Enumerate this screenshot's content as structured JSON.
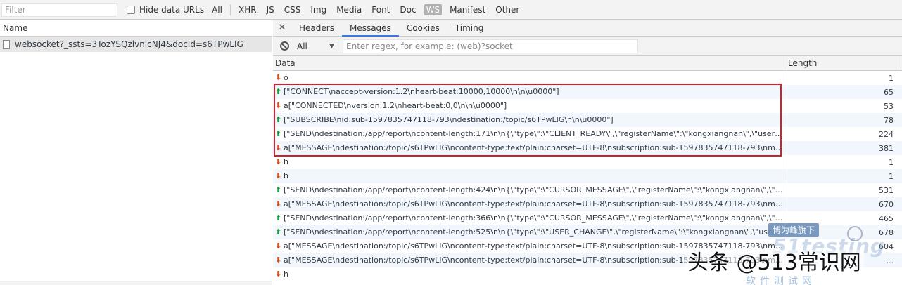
{
  "filterbar": {
    "filter_placeholder": "Filter",
    "hide_data_urls_label": "Hide data URLs",
    "types": [
      "All",
      "XHR",
      "JS",
      "CSS",
      "Img",
      "Media",
      "Font",
      "Doc",
      "WS",
      "Manifest",
      "Other"
    ],
    "active_type": "WS"
  },
  "left": {
    "column_header": "Name",
    "request_name": "websocket?_ssts=3TozYSQzlvnlcNJ4&docId=s6TPwLIG"
  },
  "right": {
    "tabs": [
      "Headers",
      "Messages",
      "Cookies",
      "Timing"
    ],
    "active_tab": "Messages",
    "filter_select": "All",
    "regex_placeholder": "Enter regex, for example: (web)?socket",
    "col_data": "Data",
    "col_length": "Length",
    "messages": [
      {
        "dir": "recv",
        "data": "o",
        "length": "1"
      },
      {
        "dir": "sent",
        "data": "[\"CONNECT\\naccept-version:1.2\\nheart-beat:10000,10000\\n\\n\\u0000\"]",
        "length": "65"
      },
      {
        "dir": "recv",
        "data": "a[\"CONNECTED\\nversion:1.2\\nheart-beat:0,0\\n\\n\\u0000\"]",
        "length": "53"
      },
      {
        "dir": "sent",
        "data": "[\"SUBSCRIBE\\nid:sub-1597835747118-793\\ndestination:/topic/s6TPwLIG\\n\\n\\u0000\"]",
        "length": "78"
      },
      {
        "dir": "sent",
        "data": "[\"SEND\\ndestination:/app/report\\ncontent-length:171\\n\\n{\\\"type\\\":\\\"CLIENT_READY\\\",\\\"registerName\\\":\\\"kongxiangnan\\\",\\\"userId\\\":...",
        "length": "224"
      },
      {
        "dir": "recv",
        "data": "a[\"MESSAGE\\ndestination:/topic/s6TPwLIG\\ncontent-type:text/plain;charset=UTF-8\\nsubscription:sub-1597835747118-793\\nmessa...",
        "length": "381"
      },
      {
        "dir": "recv",
        "data": "h",
        "length": "1"
      },
      {
        "dir": "recv",
        "data": "h",
        "length": "1"
      },
      {
        "dir": "sent",
        "data": "[\"SEND\\ndestination:/app/report\\ncontent-length:424\\n\\n{\\\"type\\\":\\\"CURSOR_MESSAGE\\\",\\\"registerName\\\":\\\"kongxiangnan\\\",\\\"user...",
        "length": "531"
      },
      {
        "dir": "recv",
        "data": "a[\"MESSAGE\\ndestination:/topic/s6TPwLIG\\ncontent-type:text/plain;charset=UTF-8\\nsubscription:sub-1597835747118-793\\nmessa...",
        "length": "670"
      },
      {
        "dir": "sent",
        "data": "[\"SEND\\ndestination:/app/report\\ncontent-length:366\\n\\n{\\\"type\\\":\\\"CURSOR_MESSAGE\\\",\\\"registerName\\\":\\\"kongxiangnan\\\",\\\"user...",
        "length": "465"
      },
      {
        "dir": "sent",
        "data": "[\"SEND\\ndestination:/app/report\\ncontent-length:525\\n\\n{\\\"type\\\":\\\"USER_CHANGE\\\",\\\"registerName\\\":\\\"kongxiangnan\\\",\\\"userId\\\"...",
        "length": "678"
      },
      {
        "dir": "recv",
        "data": "a[\"MESSAGE\\ndestination:/topic/s6TPwLIG\\ncontent-type:text/plain;charset=UTF-8\\nsubscription:sub-1597835747118-793\\nmessa...",
        "length": "604"
      },
      {
        "dir": "recv",
        "data": "a[\"MESSAGE\\ndestination:/topic/s6TPwLIG\\ncontent-type:text/plain;charset=UTF-8\\nsubscription:sub-1597835747118-793\\nmessa...",
        "length": "..."
      },
      {
        "dir": "recv",
        "data": "h",
        "length": ""
      }
    ]
  },
  "watermarks": {
    "badge": "博为峰旗下",
    "brand": "51testing",
    "toutiao": "头条 @513常识网",
    "sub": "软件测试网"
  },
  "colors": {
    "sent_arrow": "#1a9c3a",
    "recv_arrow": "#d9531e",
    "highlight_border": "#d1202b",
    "active_tab_underline": "#3879d9"
  },
  "icons": {
    "sent": "up-arrow-icon",
    "recv": "down-arrow-icon"
  }
}
